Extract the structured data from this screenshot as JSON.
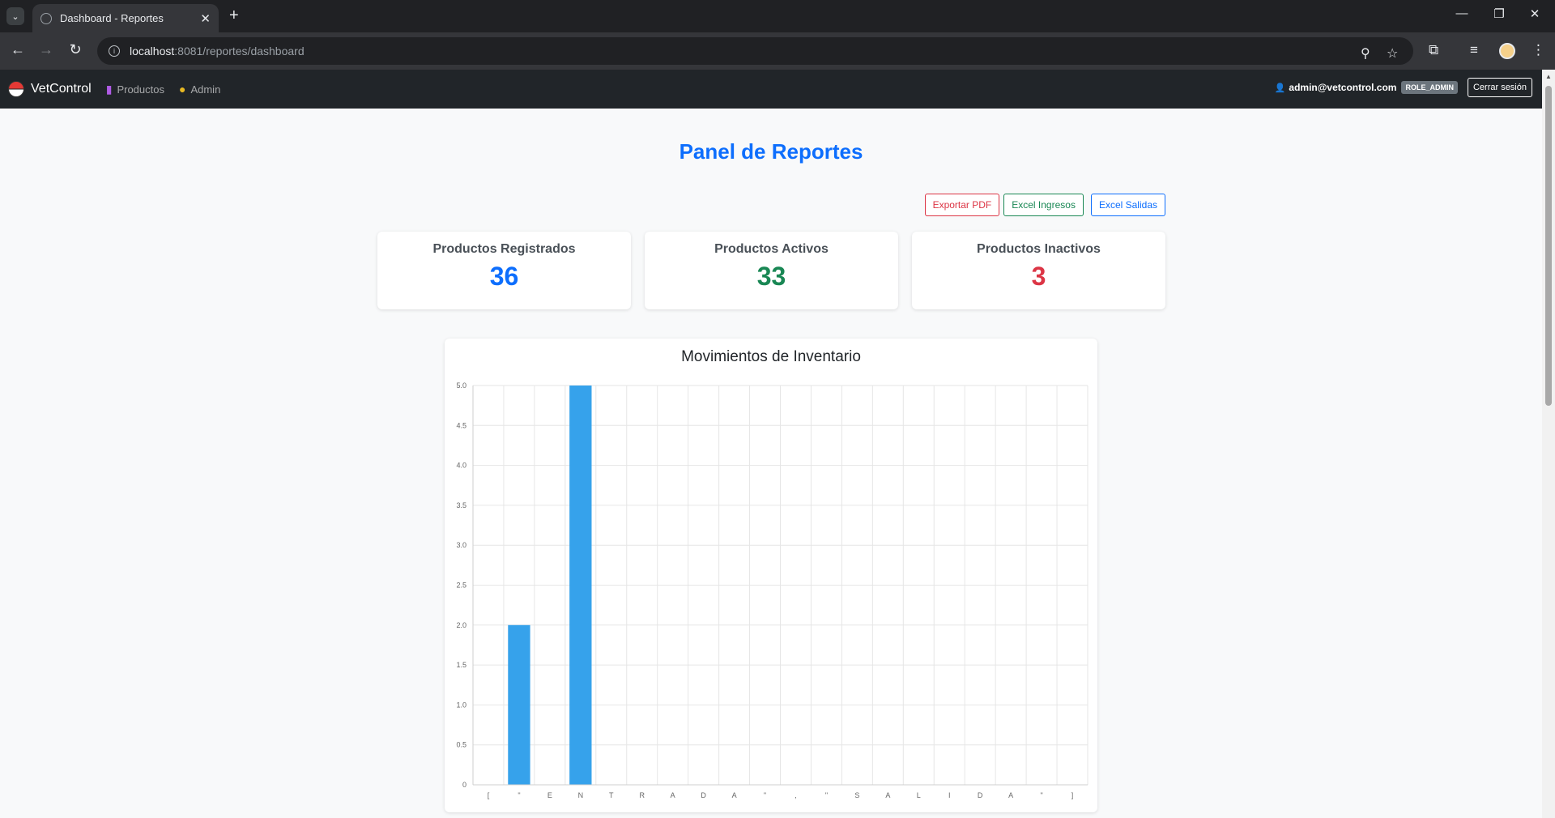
{
  "browser": {
    "tab_title": "Dashboard - Reportes",
    "url_host": "localhost",
    "url_path": ":8081/reportes/dashboard"
  },
  "navbar": {
    "brand": "VetControl",
    "links": [
      {
        "label": "Productos",
        "icon": "syringe-icon"
      },
      {
        "label": "Admin",
        "icon": "medal-icon"
      }
    ],
    "user_email": "admin@vetcontrol.com",
    "role": "ROLE_ADMIN",
    "logout": "Cerrar sesión"
  },
  "page": {
    "title": "Panel de Reportes",
    "actions": {
      "pdf": "Exportar PDF",
      "excel_in": "Excel Ingresos",
      "excel_out": "Excel Salidas"
    },
    "stats": [
      {
        "label": "Productos Registrados",
        "value": "36",
        "color": "#0d6efd"
      },
      {
        "label": "Productos Activos",
        "value": "33",
        "color": "#198754"
      },
      {
        "label": "Productos Inactivos",
        "value": "3",
        "color": "#dc3545"
      }
    ]
  },
  "chart_data": {
    "type": "bar",
    "title": "Movimientos de Inventario",
    "categories": [
      "[",
      "\"",
      "E",
      "N",
      "T",
      "R",
      "A",
      "D",
      "A",
      "\"",
      ",",
      "\"",
      "S",
      "A",
      "L",
      "I",
      "D",
      "A",
      "\"",
      "]"
    ],
    "values": [
      0,
      2,
      0,
      5,
      0,
      0,
      0,
      0,
      0,
      0,
      0,
      0,
      0,
      0,
      0,
      0,
      0,
      0,
      0,
      0
    ],
    "yticks": [
      "0",
      "0.5",
      "1.0",
      "1.5",
      "2.0",
      "2.5",
      "3.0",
      "3.5",
      "4.0",
      "4.5",
      "5.0"
    ],
    "ylim": [
      0,
      5
    ],
    "bar_color": "#36a2eb",
    "grid": true,
    "legend": "none"
  }
}
